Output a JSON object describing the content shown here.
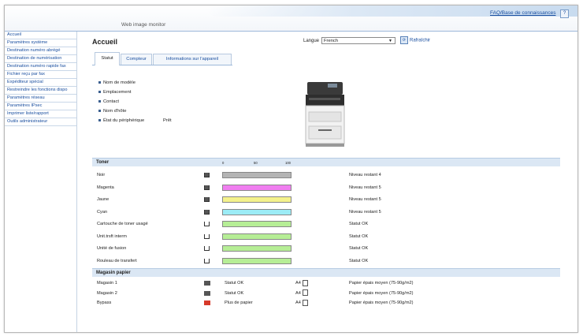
{
  "header": {
    "brand": "Web image monitor",
    "help_link": "FAQ/Base de connaissances",
    "help_icon": "?"
  },
  "sidebar": {
    "items": [
      {
        "label": "Accueil"
      },
      {
        "label": "Paramètres système"
      },
      {
        "label": "Destination numéro abrégé"
      },
      {
        "label": "Destination de numérisation"
      },
      {
        "label": "Destination numéro rapide fax"
      },
      {
        "label": "Fichier reçu par fax"
      },
      {
        "label": "Expéditeur spécial"
      },
      {
        "label": "Restreindre les fonctions dispo"
      },
      {
        "label": "Paramètres réseau"
      },
      {
        "label": "Paramètres IPsec"
      },
      {
        "label": "Imprimer liste/rapport"
      },
      {
        "label": "Outils administrateur"
      }
    ]
  },
  "main": {
    "title": "Accueil",
    "language_label": "Langue",
    "language_value": "French",
    "refresh_label": "Rafraîchir",
    "tabs": [
      {
        "label": "Statut"
      },
      {
        "label": "Compteur"
      },
      {
        "label": "Informations sur l'appareil"
      }
    ],
    "device_info": [
      {
        "label": "Nom de modèle",
        "value": ""
      },
      {
        "label": "Emplacement",
        "value": ""
      },
      {
        "label": "Contact",
        "value": ""
      },
      {
        "label": "Nom d'hôte",
        "value": ""
      },
      {
        "label": "État du périphérique",
        "value": "Prêt"
      }
    ]
  },
  "toner": {
    "title": "Toner",
    "scale": [
      "0",
      "50",
      "100"
    ],
    "rows": [
      {
        "label": "Noir",
        "color": "#b4b4b4",
        "level": 1.0,
        "status": "Niveau restant 4"
      },
      {
        "label": "Magenta",
        "color": "#f07ef0",
        "level": 1.0,
        "status": "Niveau restant 5"
      },
      {
        "label": "Jaune",
        "color": "#f4f28c",
        "level": 1.0,
        "status": "Niveau restant 5"
      },
      {
        "label": "Cyan",
        "color": "#9cecf6",
        "level": 1.0,
        "status": "Niveau restant 5"
      },
      {
        "label": "Cartouche de toner usagé",
        "color": "#b6ee96",
        "level": 1.0,
        "status": "Statut OK"
      },
      {
        "label": "Unit.trsft interm",
        "color": "#b6ee96",
        "level": 1.0,
        "status": "Statut OK"
      },
      {
        "label": "Unité de fusion",
        "color": "#b6ee96",
        "level": 1.0,
        "status": "Statut OK"
      },
      {
        "label": "Rouleau de transfert",
        "color": "#b6ee96",
        "level": 1.0,
        "status": "Statut OK"
      }
    ]
  },
  "paper": {
    "title": "Magasin papier",
    "rows": [
      {
        "label": "Magasin 1",
        "status": "Statut OK",
        "size": "A4",
        "type": "Papier épais moyen (75-90g/m2)",
        "error": false
      },
      {
        "label": "Magasin 2",
        "status": "Statut OK",
        "size": "A4",
        "type": "Papier épais moyen (75-90g/m2)",
        "error": false
      },
      {
        "label": "Bypass",
        "status": "Plus de papier",
        "size": "A4",
        "type": "Papier épais moyen (75-90g/m2)",
        "error": true
      }
    ]
  }
}
